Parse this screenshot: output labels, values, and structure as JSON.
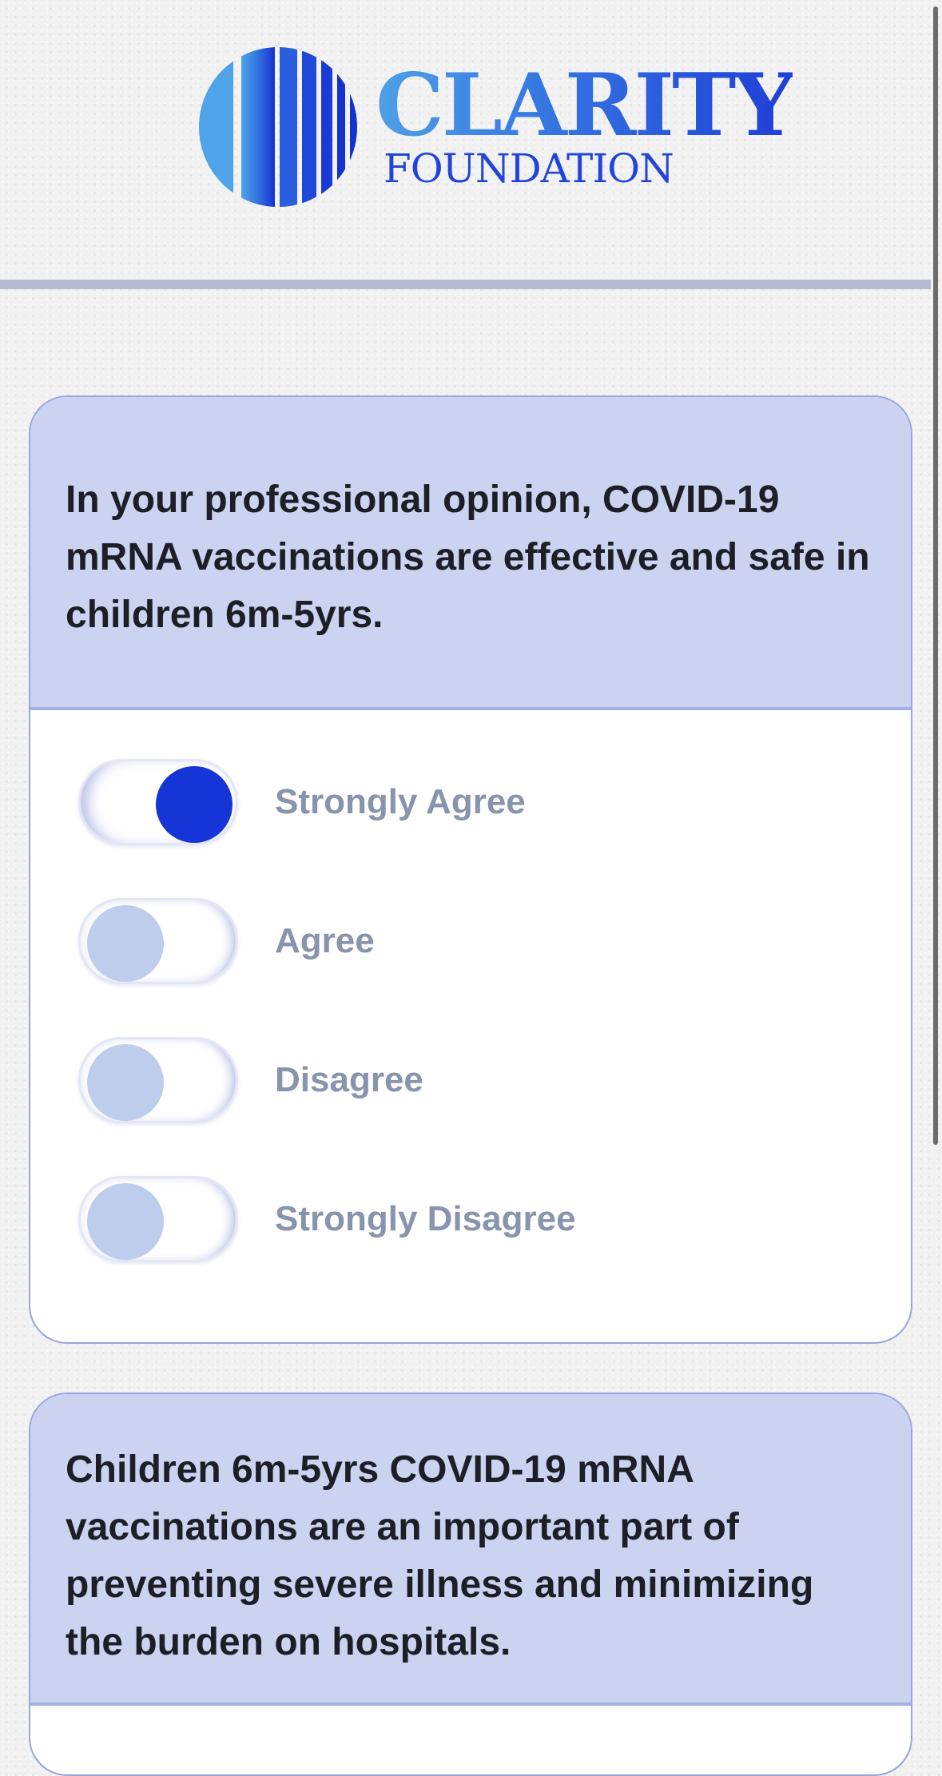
{
  "brand": {
    "title": "CLARITY",
    "subtitle": "FOUNDATION",
    "colors": {
      "light_blue": "#4fa0e6",
      "dark_blue": "#1f3ed6"
    }
  },
  "theme": {
    "card_header_bg": "#ccd3f0",
    "card_border": "#9aa6db",
    "toggle_on": "#1535d6",
    "toggle_off": "#bfcdec",
    "option_text": "#8893ad",
    "question_text": "#1d1f27"
  },
  "questions": [
    {
      "text": "In your professional opinion, COVID-19 mRNA vaccinations are effective and safe in children 6m-5yrs.",
      "selected": "Strongly Agree",
      "options": [
        {
          "label": "Strongly Agree",
          "checked": true
        },
        {
          "label": "Agree",
          "checked": false
        },
        {
          "label": "Disagree",
          "checked": false
        },
        {
          "label": "Strongly Disagree",
          "checked": false
        }
      ]
    },
    {
      "text": "Children 6m-5yrs COVID-19 mRNA vaccinations are an important part of preventing severe illness and minimizing the burden on hospitals."
    }
  ]
}
